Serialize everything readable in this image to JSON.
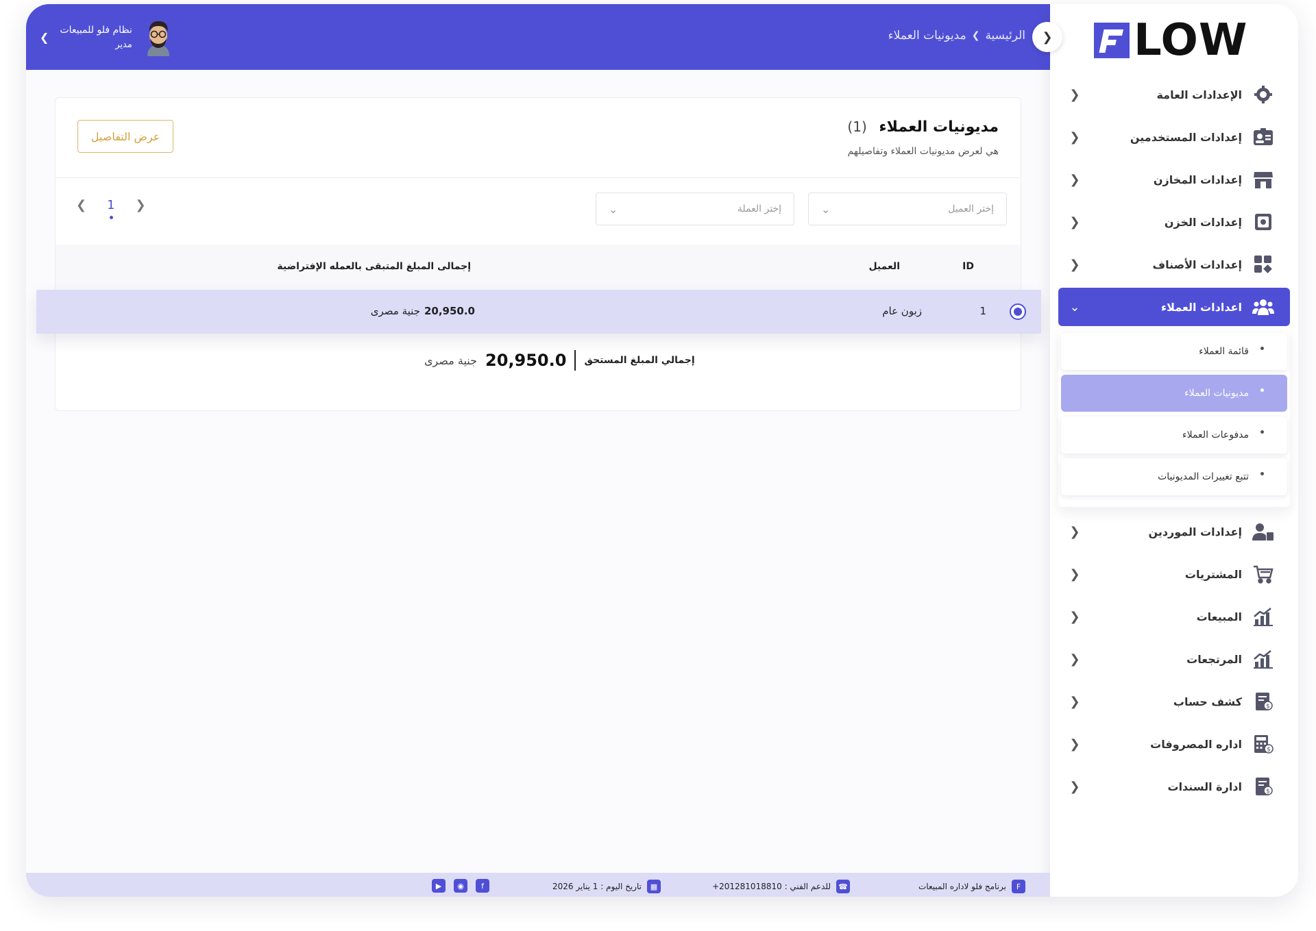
{
  "app": {
    "logo_text": "LOW",
    "brand_color": "#4f4fd6"
  },
  "header": {
    "breadcrumb_home": "الرئيسية",
    "breadcrumb_current": "مديونيات العملاء",
    "user_name": "نظام فلو للمبيعات",
    "user_role": "مدير"
  },
  "sidebar": {
    "items": [
      {
        "label": "الإعدادات العامة",
        "icon": "gear-icon"
      },
      {
        "label": "إعدادات المستخدمين",
        "icon": "user-card-icon"
      },
      {
        "label": "إعدادات المخازن",
        "icon": "store-icon"
      },
      {
        "label": "إعدادات الخزن",
        "icon": "safe-icon"
      },
      {
        "label": "إعدادات الأصناف",
        "icon": "categories-icon"
      },
      {
        "label": "اعدادات العملاء",
        "icon": "users-icon",
        "active": true
      },
      {
        "label": "إعدادات الموردين",
        "icon": "supplier-icon"
      },
      {
        "label": "المشتريات",
        "icon": "cart-icon"
      },
      {
        "label": "المبيعات",
        "icon": "sales-chart-icon"
      },
      {
        "label": "المرتجعات",
        "icon": "returns-chart-icon"
      },
      {
        "label": "كشف حساب",
        "icon": "statement-icon"
      },
      {
        "label": "اداره المصروفات",
        "icon": "calculator-icon"
      },
      {
        "label": "ادارة السندات",
        "icon": "voucher-icon"
      }
    ],
    "submenu": [
      {
        "label": "قائمة العملاء"
      },
      {
        "label": "مديونيات العملاء",
        "selected": true
      },
      {
        "label": "مدفوعات العملاء"
      },
      {
        "label": "تتبع تغييرات المديونيات"
      }
    ]
  },
  "card": {
    "title": "مديونيات العملاء",
    "count": "(1)",
    "subtitle": "هي لعرض مديونيات العملاء وتفاصيلهم",
    "details_button": "عرض التفاصيل",
    "customer_select_placeholder": "إختر العميل",
    "currency_select_placeholder": "إختر العملة",
    "page_number": "1"
  },
  "table": {
    "headers": {
      "id": "ID",
      "customer": "العميل",
      "total": "إجمالى المبلغ المتبقى بالعمله الإفتراضية"
    },
    "rows": [
      {
        "id": "1",
        "customer": "زبون عام",
        "amount": "20,950.0",
        "currency": "جنية مصرى"
      }
    ]
  },
  "summary": {
    "label": "إجمالي المبلغ المستحق",
    "value": "20,950.0",
    "currency": "جنية مصرى"
  },
  "footer": {
    "program": "برنامج فلو لاداره المبيعات",
    "support": "للدعم الفني : 201281018810+",
    "date": "تاريخ اليوم : 1 يناير 2026"
  }
}
